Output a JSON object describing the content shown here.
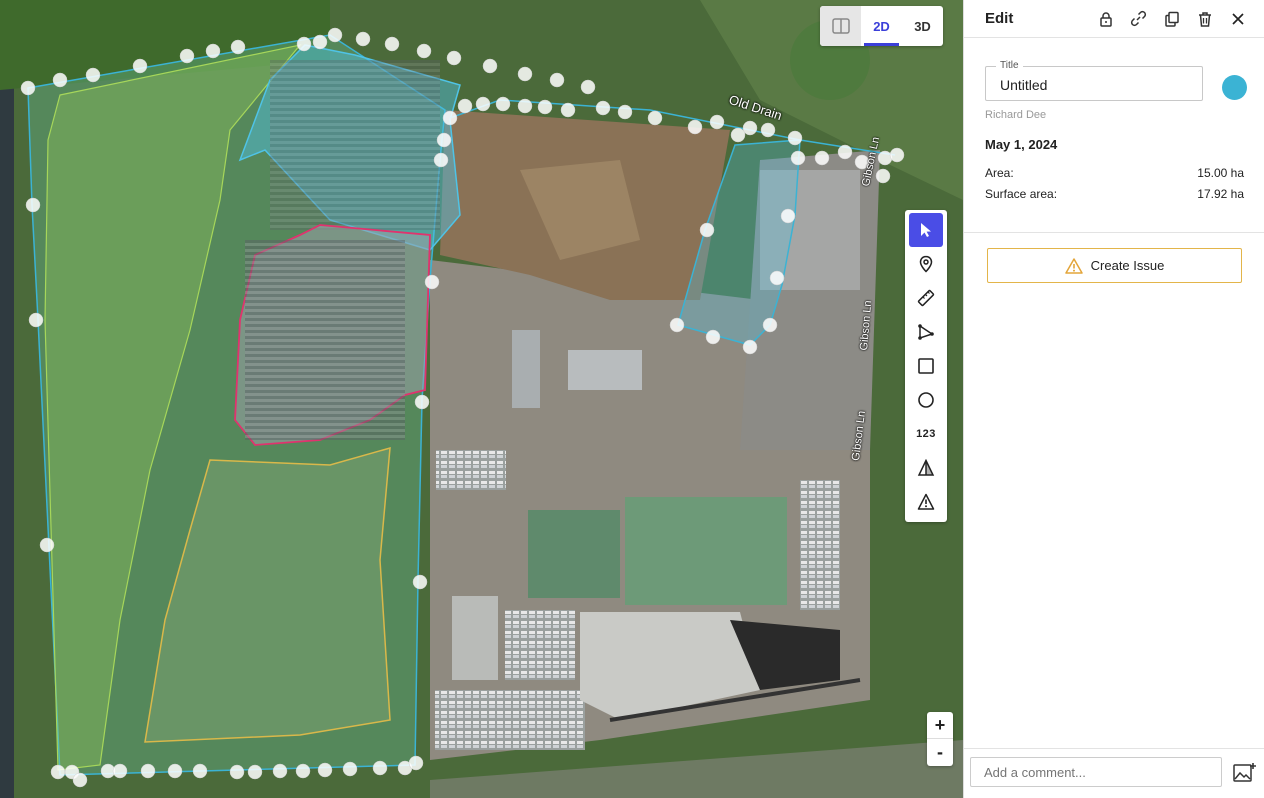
{
  "map": {
    "view_toggle": {
      "split_icon": "split-view-icon",
      "btn_2d": "2D",
      "btn_3d": "3D",
      "active": "2D"
    },
    "labels": {
      "drain": "Old Drain",
      "road_upper": "Gibson Ln",
      "road_mid": "Gibson Ln",
      "road_lower": "Gibson Ln"
    },
    "tools": [
      {
        "name": "select",
        "icon": "cursor-icon",
        "active": true
      },
      {
        "name": "marker",
        "icon": "map-pin-icon"
      },
      {
        "name": "measure",
        "icon": "ruler-icon"
      },
      {
        "name": "polyline",
        "icon": "polyline-icon"
      },
      {
        "name": "rectangle",
        "icon": "square-icon"
      },
      {
        "name": "circle",
        "icon": "circle-icon"
      },
      {
        "name": "count",
        "icon": "count-icon",
        "label": "123"
      },
      {
        "name": "volume",
        "icon": "triangle-split-icon"
      },
      {
        "name": "issue",
        "icon": "warning-icon"
      }
    ],
    "zoom": {
      "in": "+",
      "out": "-"
    },
    "colors": {
      "boundary": "#3bb3d4",
      "selected_fill": "#4fc3e6",
      "red_zone": "#e0336e",
      "yellow_zone": "#d9b84a",
      "green_zone": "#a6d65a"
    }
  },
  "panel": {
    "header": {
      "title": "Edit",
      "icons": [
        "lock-icon",
        "link-icon",
        "copy-icon",
        "trash-icon",
        "close-icon"
      ]
    },
    "title_field": {
      "label": "Title",
      "value": "Untitled"
    },
    "color_swatch": "#3bb3d4",
    "author": "Richard Dee",
    "date": "May 1, 2024",
    "area": {
      "label": "Area:",
      "value": "15.00 ha"
    },
    "surface_area": {
      "label": "Surface area:",
      "value": "17.92 ha"
    },
    "create_issue": {
      "label": "Create Issue",
      "icon": "warning-icon"
    },
    "comment": {
      "placeholder": "Add a comment..."
    },
    "attach_icon": "add-image-icon"
  }
}
